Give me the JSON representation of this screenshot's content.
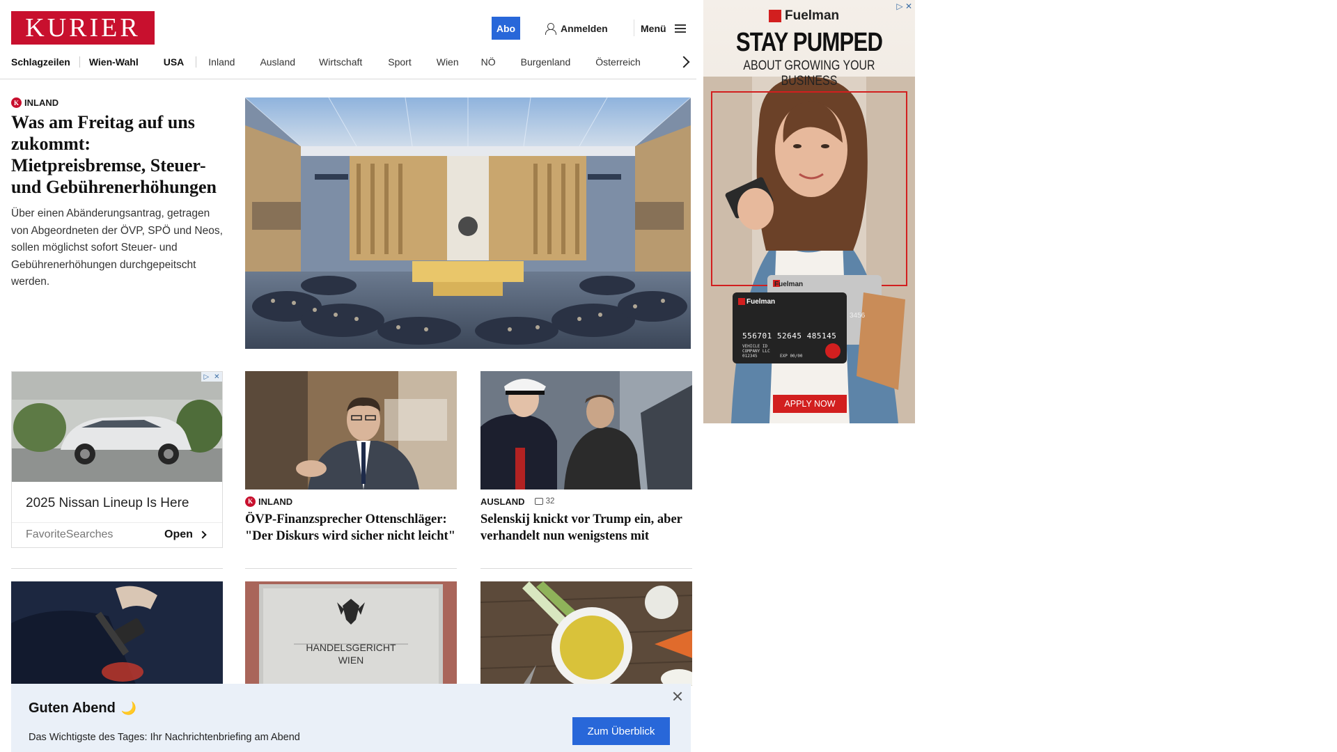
{
  "header": {
    "logo_text": "KURIER",
    "abo_label": "Abo",
    "login_label": "Anmelden",
    "menu_label": "Menü"
  },
  "nav": {
    "items": [
      "Schlagzeilen",
      "Wien-Wahl",
      "USA",
      "Inland",
      "Ausland",
      "Wirtschaft",
      "Sport",
      "Wien",
      "NÖ",
      "Burgenland",
      "Österreich"
    ]
  },
  "hero": {
    "category": "INLAND",
    "title": "Was am Freitag auf uns zukommt: Mietpreisbremse, Steuer- und Gebührenerhöhungen",
    "teaser": "Über einen Abänderungsantrag, getragen von Abgeordneten der ÖVP, SPÖ und Neos, sollen möglichst sofort Steuer- und Gebührenerhöhungen durchgepeitscht werden."
  },
  "ad_nissan": {
    "headline": "2025 Nissan Lineup Is Here",
    "source": "FavoriteSearches",
    "open_label": "Open"
  },
  "articles": [
    {
      "category": "INLAND",
      "title": "ÖVP-Finanzsprecher Ottenschläger: \"Der Diskurs wird sicher nicht leicht\""
    },
    {
      "category": "AUSLAND",
      "comments": "32",
      "title": "Selenskij knickt vor Trump ein, aber verhandelt nun wenigstens mit"
    }
  ],
  "row3": {
    "court_sign_line1": "HANDELSGERICHT",
    "court_sign_line2": "WIEN"
  },
  "briefing": {
    "greeting": "Guten Abend",
    "greeting_emoji": "🌙",
    "description": "Das Wichtigste des Tages: Ihr Nachrichtenbriefing am Abend",
    "cta_label": "Zum Überblick"
  },
  "ad_fuelman": {
    "brand": "Fuelman",
    "headline": "STAY PUMPED",
    "subline": "ABOUT GROWING YOUR BUSINESS",
    "card_brand": "Fuelman",
    "card_number": "556701 52645 485145",
    "card_back_digits": "3456",
    "card_line1": "VEHICLE ID",
    "card_line2": "COMPANY LLC",
    "card_line3": "012345",
    "card_exp": "EXP 00/00",
    "cta_label": "APPLY NOW"
  },
  "colors": {
    "brand_red": "#c8102e",
    "accent_blue": "#2867d9",
    "briefing_bg": "#eaf0f8",
    "ad_red": "#d21f1f"
  }
}
